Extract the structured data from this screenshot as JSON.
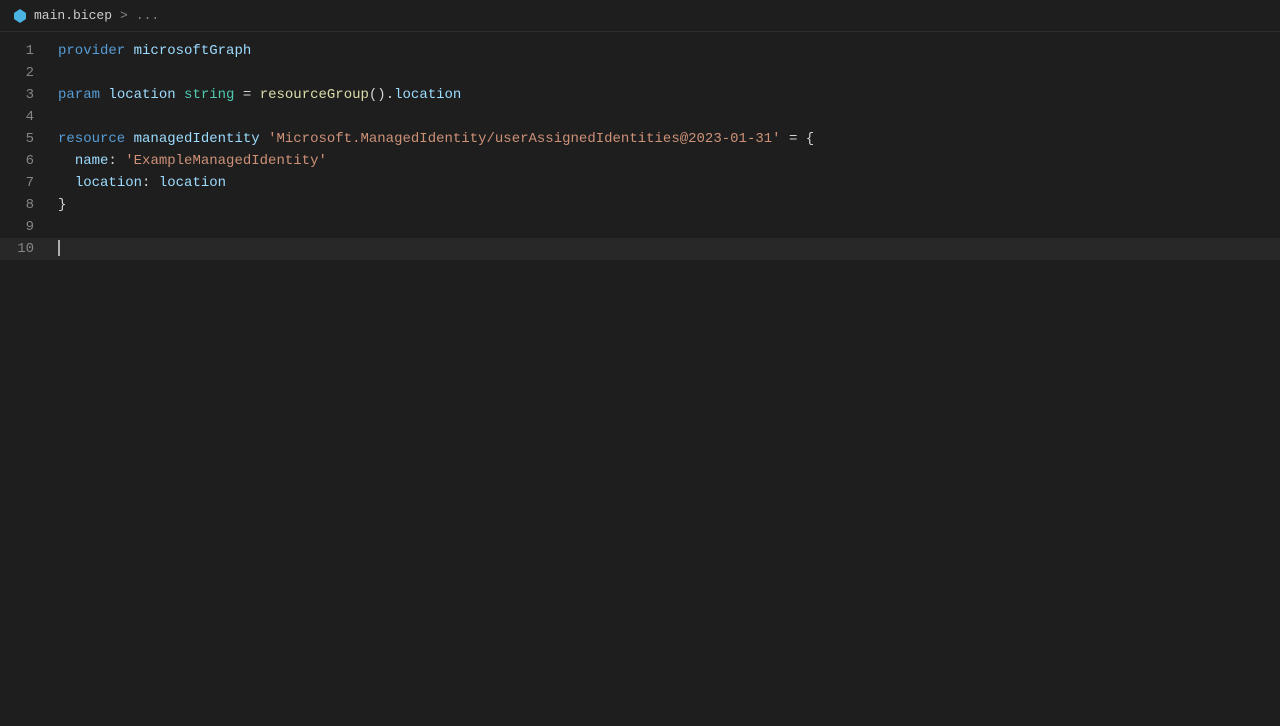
{
  "titlebar": {
    "icon": "🔷",
    "filename": "main.bicep",
    "separator": ">",
    "breadcrumb": "..."
  },
  "lines": [
    {
      "number": 1,
      "tokens": [
        {
          "text": "provider",
          "class": "kw-provider"
        },
        {
          "text": " ",
          "class": "kw-punct"
        },
        {
          "text": "microsoftGraph",
          "class": "kw-identifier"
        }
      ]
    },
    {
      "number": 2,
      "tokens": []
    },
    {
      "number": 3,
      "tokens": [
        {
          "text": "param",
          "class": "kw-keyword"
        },
        {
          "text": " ",
          "class": "kw-punct"
        },
        {
          "text": "location",
          "class": "kw-identifier"
        },
        {
          "text": " ",
          "class": "kw-punct"
        },
        {
          "text": "string",
          "class": "kw-type"
        },
        {
          "text": " = ",
          "class": "kw-punct"
        },
        {
          "text": "resourceGroup",
          "class": "kw-function"
        },
        {
          "text": "().",
          "class": "kw-punct"
        },
        {
          "text": "location",
          "class": "kw-property"
        }
      ]
    },
    {
      "number": 4,
      "tokens": []
    },
    {
      "number": 5,
      "tokens": [
        {
          "text": "resource",
          "class": "kw-keyword"
        },
        {
          "text": " ",
          "class": "kw-punct"
        },
        {
          "text": "managedIdentity",
          "class": "kw-identifier"
        },
        {
          "text": " ",
          "class": "kw-punct"
        },
        {
          "text": "'Microsoft.ManagedIdentity/userAssignedIdentities@2023-01-31'",
          "class": "kw-resource-type"
        },
        {
          "text": " = {",
          "class": "kw-punct"
        }
      ]
    },
    {
      "number": 6,
      "tokens": [
        {
          "text": "  ",
          "class": "kw-punct"
        },
        {
          "text": "name",
          "class": "kw-property"
        },
        {
          "text": ": ",
          "class": "kw-punct"
        },
        {
          "text": "'ExampleManagedIdentity'",
          "class": "kw-string"
        }
      ]
    },
    {
      "number": 7,
      "tokens": [
        {
          "text": "  ",
          "class": "kw-punct"
        },
        {
          "text": "location",
          "class": "kw-property"
        },
        {
          "text": ": ",
          "class": "kw-punct"
        },
        {
          "text": "location",
          "class": "kw-identifier"
        }
      ]
    },
    {
      "number": 8,
      "tokens": [
        {
          "text": "}",
          "class": "kw-punct"
        }
      ]
    },
    {
      "number": 9,
      "tokens": []
    },
    {
      "number": 10,
      "tokens": [],
      "active": true,
      "cursor": true
    }
  ]
}
